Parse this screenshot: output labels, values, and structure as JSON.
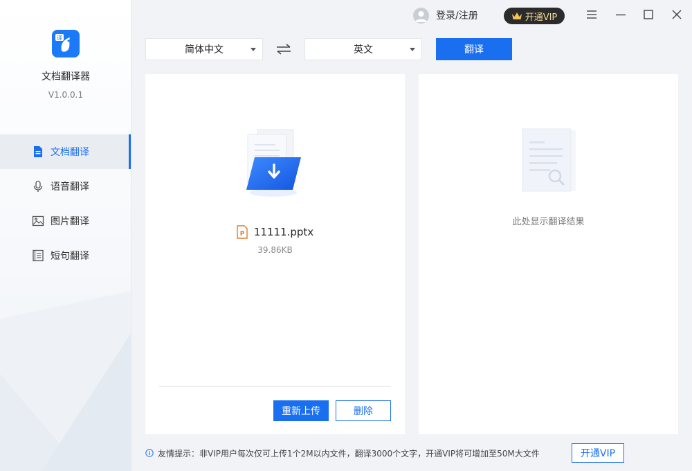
{
  "app": {
    "name": "文档翻译器",
    "version": "V1.0.0.1",
    "logo_badge": "译"
  },
  "sidebar": {
    "items": [
      {
        "label": "文档翻译",
        "icon": "document-icon",
        "active": true
      },
      {
        "label": "语音翻译",
        "icon": "microphone-icon",
        "active": false
      },
      {
        "label": "图片翻译",
        "icon": "image-icon",
        "active": false
      },
      {
        "label": "短句翻译",
        "icon": "text-lines-icon",
        "active": false
      }
    ]
  },
  "header": {
    "login_label": "登录/注册",
    "vip_label": "开通VIP"
  },
  "language_bar": {
    "source_language": "简体中文",
    "target_language": "英文",
    "translate_label": "翻译"
  },
  "file": {
    "name": "11111.pptx",
    "size": "39.86KB"
  },
  "actions": {
    "reupload_label": "重新上传",
    "delete_label": "删除"
  },
  "result": {
    "placeholder": "此处显示翻译结果"
  },
  "footer": {
    "tip": "友情提示：非VIP用户每次仅可上传1个2M以内文件，翻译3000个文字，开通VIP将可增加至50M大文件",
    "vip_button_label": "开通VIP"
  },
  "colors": {
    "accent": "#1a6ff0",
    "vip_bg": "#2b2b2b",
    "vip_text": "#f3d99a",
    "file_icon": "#e07a2c"
  }
}
